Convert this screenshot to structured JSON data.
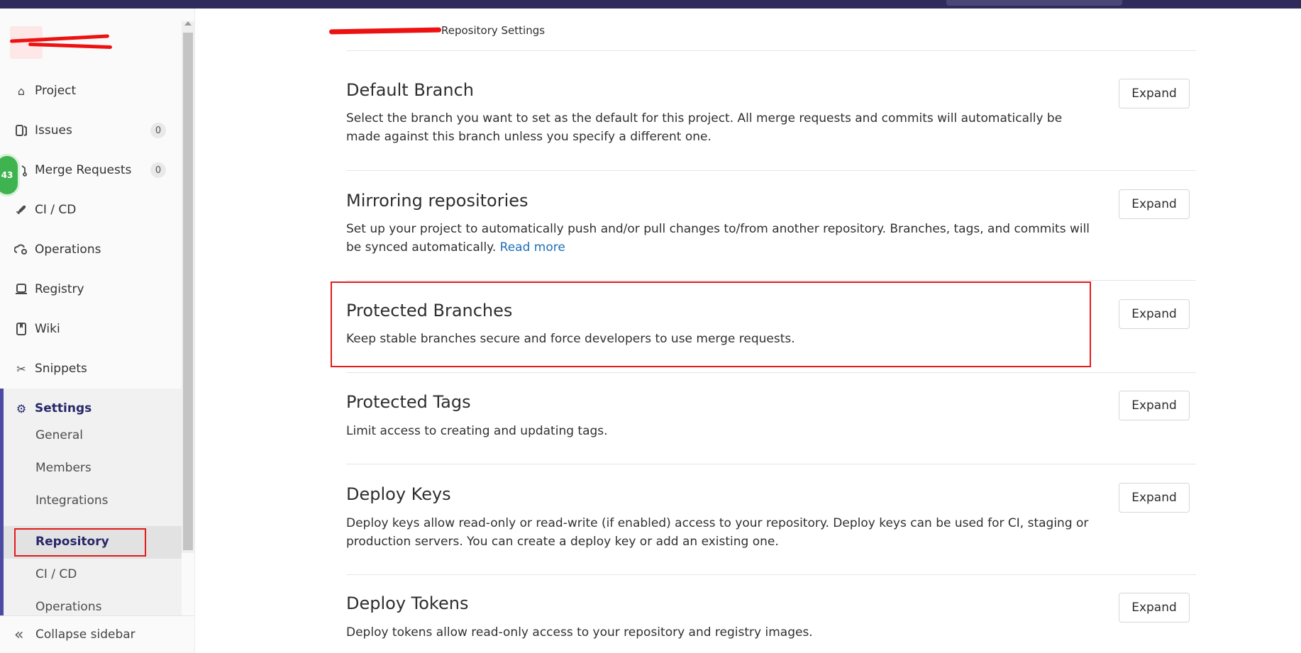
{
  "breadcrumb": {
    "current": "Repository Settings"
  },
  "sidebar": {
    "items": [
      {
        "label": "Project",
        "icon": "home-icon"
      },
      {
        "label": "Issues",
        "icon": "issues-icon",
        "badge": "0"
      },
      {
        "label": "Merge Requests",
        "icon": "merge-request-icon",
        "badge": "0"
      },
      {
        "label": "CI / CD",
        "icon": "rocket-icon"
      },
      {
        "label": "Operations",
        "icon": "cloud-gear-icon"
      },
      {
        "label": "Registry",
        "icon": "registry-icon"
      },
      {
        "label": "Wiki",
        "icon": "book-icon"
      },
      {
        "label": "Snippets",
        "icon": "scissors-icon"
      }
    ],
    "settings": {
      "label": "Settings",
      "icon": "gear-icon",
      "subitems": [
        "General",
        "Members",
        "Integrations",
        "Repository",
        "CI / CD",
        "Operations"
      ],
      "active": "Repository"
    },
    "collapse_label": "Collapse sidebar",
    "bubble_count": "43"
  },
  "sections": [
    {
      "title": "Default Branch",
      "desc": "Select the branch you want to set as the default for this project. All merge requests and commits will automatically be made against this branch unless you specify a different one."
    },
    {
      "title": "Mirroring repositories",
      "desc": "Set up your project to automatically push and/or pull changes to/from another repository. Branches, tags, and commits will be synced automatically.",
      "link": "Read more"
    },
    {
      "title": "Protected Branches",
      "desc": "Keep stable branches secure and force developers to use merge requests."
    },
    {
      "title": "Protected Tags",
      "desc": "Limit access to creating and updating tags."
    },
    {
      "title": "Deploy Keys",
      "desc": "Deploy keys allow read-only or read-write (if enabled) access to your repository. Deploy keys can be used for CI, staging or production servers. You can create a deploy key or add an existing one."
    },
    {
      "title": "Deploy Tokens",
      "desc": "Deploy tokens allow read-only access to your repository and registry images."
    }
  ],
  "expand_label": "Expand",
  "colors": {
    "accent": "#27276b",
    "highlight": "#e21b1b",
    "link": "#1f6eb8",
    "topbar": "#2f2b5a"
  }
}
